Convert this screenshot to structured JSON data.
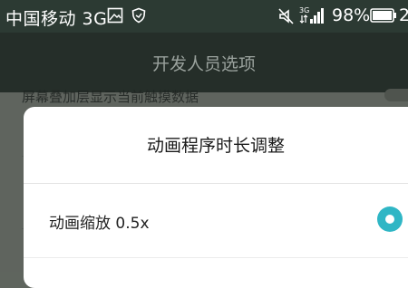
{
  "status_bar": {
    "carrier": "中国移动 3G",
    "network_small_label": "3G",
    "battery_percent": "98%",
    "clock_partial": "2",
    "icons": [
      "image-icon",
      "shield-icon",
      "mute-icon",
      "signal-icon",
      "battery-icon"
    ]
  },
  "app_bar": {
    "title": "开发人员选项"
  },
  "background_list": {
    "partial_item": "屏幕叠加层显示当前触摸数据"
  },
  "dialog": {
    "title": "动画程序时长调整",
    "options": [
      {
        "label": "动画缩放 0.5x",
        "selected": true
      }
    ],
    "accent_color": "#2fb6c5"
  }
}
